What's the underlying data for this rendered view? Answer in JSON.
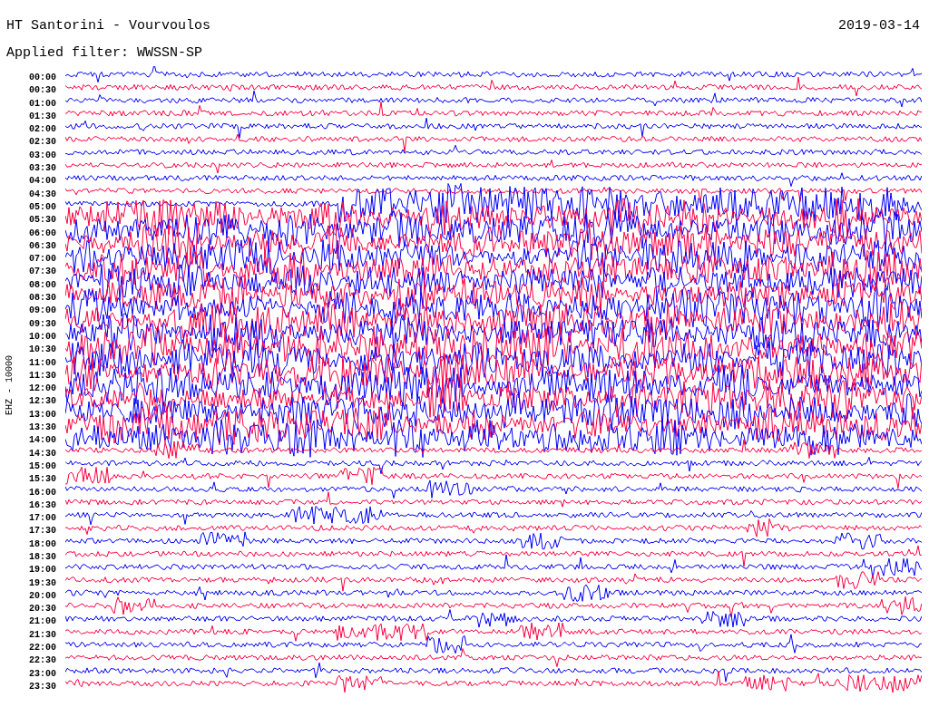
{
  "header": {
    "title": "HT Santorini - Vourvoulos",
    "date": "2019-03-14",
    "filter": "Applied filter: WWSSN-SP"
  },
  "axis_label": "EHZ - 10000",
  "rows": [
    {
      "label": "00:00",
      "color": "#0000ff"
    },
    {
      "label": "00:30",
      "color": "#ff0040"
    },
    {
      "label": "01:00",
      "color": "#0000ff"
    },
    {
      "label": "01:30",
      "color": "#ff0040"
    },
    {
      "label": "02:00",
      "color": "#0000ff"
    },
    {
      "label": "02:30",
      "color": "#ff0040"
    },
    {
      "label": "03:00",
      "color": "#0000ff"
    },
    {
      "label": "03:30",
      "color": "#ff0040"
    },
    {
      "label": "04:00",
      "color": "#0000ff"
    },
    {
      "label": "04:30",
      "color": "#ff0040"
    },
    {
      "label": "05:00",
      "color": "#0000ff"
    },
    {
      "label": "05:30",
      "color": "#ff0040"
    },
    {
      "label": "06:00",
      "color": "#0000ff"
    },
    {
      "label": "06:30",
      "color": "#ff0040"
    },
    {
      "label": "07:00",
      "color": "#0000ff"
    },
    {
      "label": "07:30",
      "color": "#ff0040"
    },
    {
      "label": "08:00",
      "color": "#0000ff"
    },
    {
      "label": "08:30",
      "color": "#ff0040"
    },
    {
      "label": "09:00",
      "color": "#0000ff"
    },
    {
      "label": "09:30",
      "color": "#ff0040"
    },
    {
      "label": "10:00",
      "color": "#0000ff"
    },
    {
      "label": "10:30",
      "color": "#ff0040"
    },
    {
      "label": "11:00",
      "color": "#0000ff"
    },
    {
      "label": "11:30",
      "color": "#ff0040"
    },
    {
      "label": "12:00",
      "color": "#0000ff"
    },
    {
      "label": "12:30",
      "color": "#ff0040"
    },
    {
      "label": "13:00",
      "color": "#0000ff"
    },
    {
      "label": "13:30",
      "color": "#ff0040"
    },
    {
      "label": "14:00",
      "color": "#0000ff"
    },
    {
      "label": "14:30",
      "color": "#ff0040"
    },
    {
      "label": "15:00",
      "color": "#0000ff"
    },
    {
      "label": "15:30",
      "color": "#ff0040"
    },
    {
      "label": "16:00",
      "color": "#0000ff"
    },
    {
      "label": "16:30",
      "color": "#ff0040"
    },
    {
      "label": "17:00",
      "color": "#0000ff"
    },
    {
      "label": "17:30",
      "color": "#ff0040"
    },
    {
      "label": "18:00",
      "color": "#0000ff"
    },
    {
      "label": "18:30",
      "color": "#ff0040"
    },
    {
      "label": "19:00",
      "color": "#0000ff"
    },
    {
      "label": "19:30",
      "color": "#ff0040"
    },
    {
      "label": "20:00",
      "color": "#0000ff"
    },
    {
      "label": "20:30",
      "color": "#ff0040"
    },
    {
      "label": "21:00",
      "color": "#0000ff"
    },
    {
      "label": "21:30",
      "color": "#ff0040"
    },
    {
      "label": "22:00",
      "color": "#0000ff"
    },
    {
      "label": "22:30",
      "color": "#ff0040"
    },
    {
      "label": "23:00",
      "color": "#0000ff"
    },
    {
      "label": "23:30",
      "color": "#ff0040"
    }
  ]
}
